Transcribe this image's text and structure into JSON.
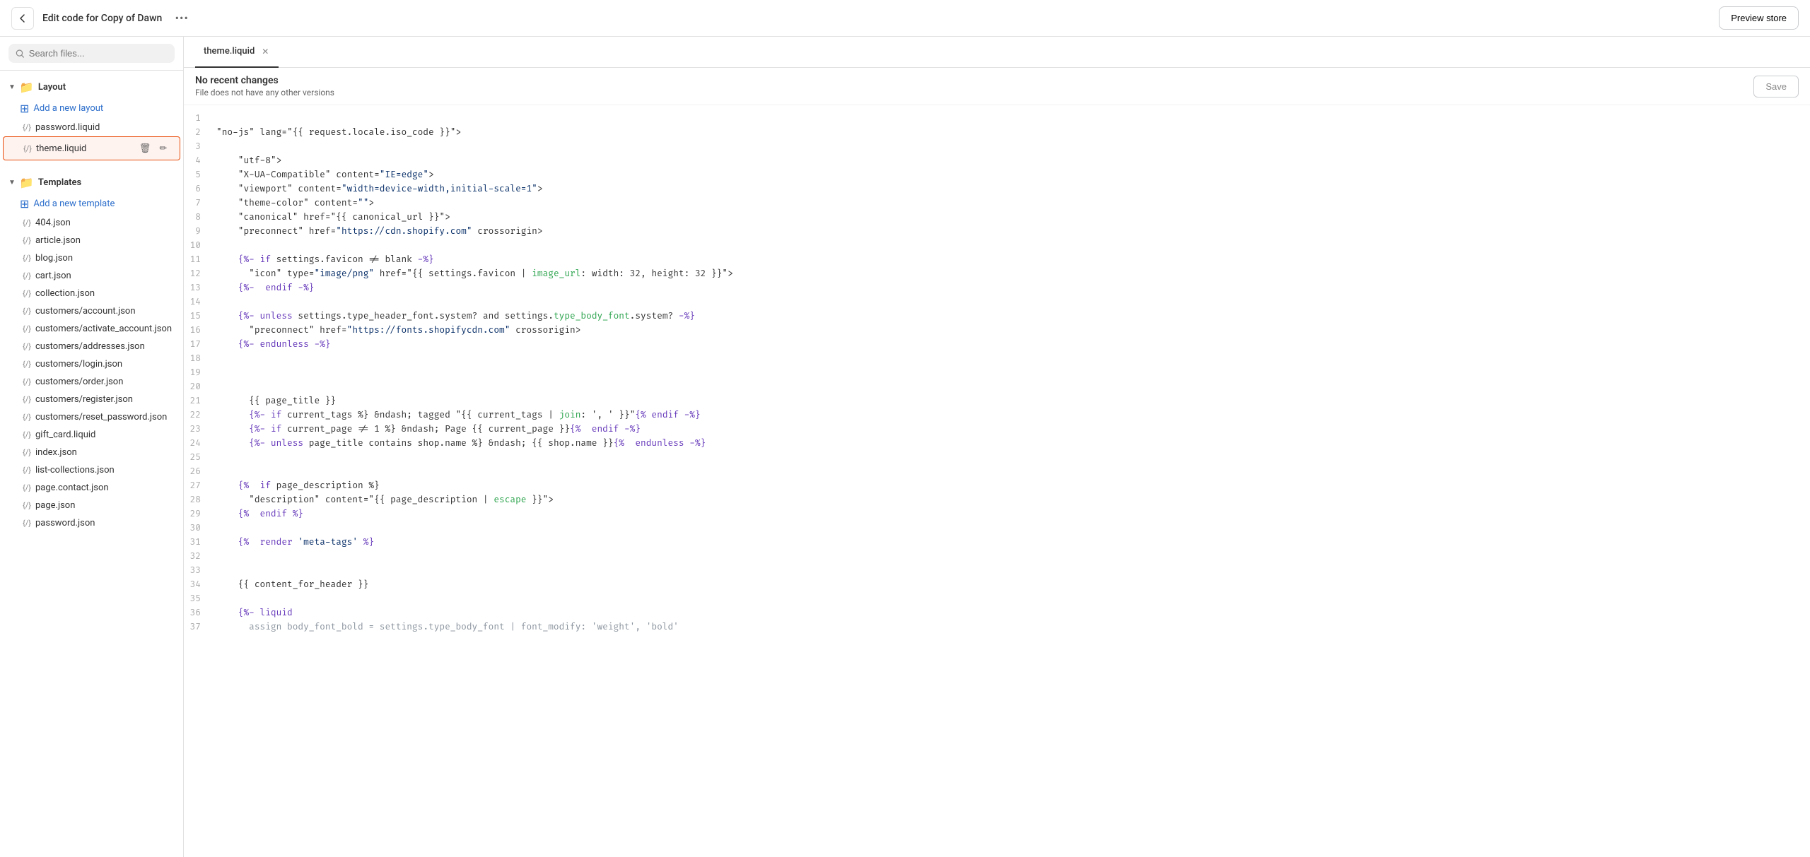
{
  "topbar": {
    "title": "Edit code for Copy of Dawn",
    "more_label": "•••",
    "preview_label": "Preview store"
  },
  "sidebar": {
    "search_placeholder": "Search files...",
    "layout_section": {
      "label": "Layout",
      "add_label": "Add a new layout",
      "items": [
        {
          "name": "password.liquid",
          "icon": "{/}"
        },
        {
          "name": "theme.liquid",
          "icon": "{/}",
          "active": true
        }
      ]
    },
    "templates_section": {
      "label": "Templates",
      "add_label": "Add a new template",
      "items": [
        {
          "name": "404.json",
          "icon": "{/}"
        },
        {
          "name": "article.json",
          "icon": "{/}"
        },
        {
          "name": "blog.json",
          "icon": "{/}"
        },
        {
          "name": "cart.json",
          "icon": "{/}"
        },
        {
          "name": "collection.json",
          "icon": "{/}"
        },
        {
          "name": "customers/account.json",
          "icon": "{/}"
        },
        {
          "name": "customers/activate_account.json",
          "icon": "{/}"
        },
        {
          "name": "customers/addresses.json",
          "icon": "{/}"
        },
        {
          "name": "customers/login.json",
          "icon": "{/}"
        },
        {
          "name": "customers/order.json",
          "icon": "{/}"
        },
        {
          "name": "customers/register.json",
          "icon": "{/}"
        },
        {
          "name": "customers/reset_password.json",
          "icon": "{/}"
        },
        {
          "name": "gift_card.liquid",
          "icon": "{/}"
        },
        {
          "name": "index.json",
          "icon": "{/}"
        },
        {
          "name": "list-collections.json",
          "icon": "{/}"
        },
        {
          "name": "page.contact.json",
          "icon": "{/}"
        },
        {
          "name": "page.json",
          "icon": "{/}"
        },
        {
          "name": "password.json",
          "icon": "{/}"
        }
      ]
    }
  },
  "editor": {
    "tab_label": "theme.liquid",
    "no_changes": "No recent changes",
    "sub_info": "File does not have any other versions",
    "save_label": "Save"
  },
  "actions": {
    "delete_icon": "🗑",
    "edit_icon": "✏"
  }
}
